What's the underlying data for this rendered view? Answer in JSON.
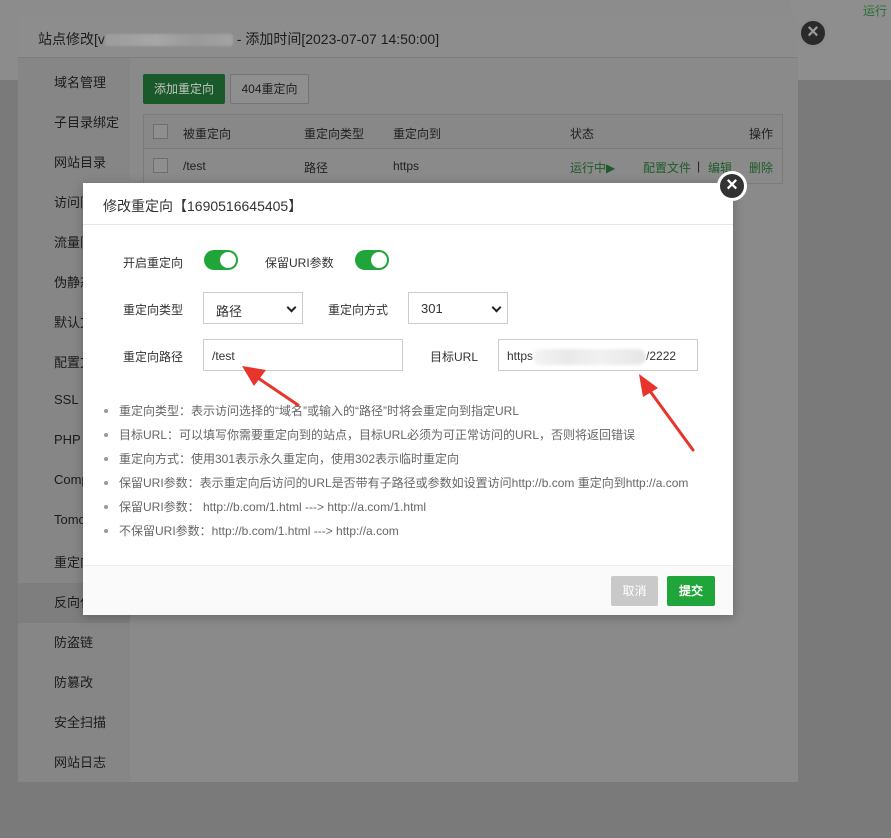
{
  "background": {
    "run_status": "运行"
  },
  "outer_modal": {
    "title_prefix": "站点修改[",
    "title_prefix_tail": "v",
    "title_suffix": " - 添加时间[2023-07-07 14:50:00]",
    "close_glyph": "×",
    "sidebar": [
      "域名管理",
      "子目录绑定",
      "网站目录",
      "访问限",
      "流量限",
      "伪静态",
      "默认文",
      "配置文",
      "SSL",
      "PHP",
      "Comp",
      "Tomc",
      "重定向",
      "反向代",
      "防盗链",
      "防篡改",
      "安全扫描",
      "网站日志"
    ],
    "buttons": {
      "add": "添加重定向",
      "not_found": "404重定向"
    },
    "table": {
      "headers": {
        "source": "被重定向",
        "type": "重定向类型",
        "target": "重定向到",
        "status": "状态",
        "ops": "操作"
      },
      "row": {
        "source": "/test",
        "type": "路径",
        "target": "https",
        "status": "运行中▶",
        "op_config": "配置文件",
        "op_sep": "|",
        "op_edit": "编辑",
        "op_delete": "删除"
      }
    }
  },
  "inner_modal": {
    "title": "修改重定向【1690516645405】",
    "close_glyph": "×",
    "enable_label": "开启重定向",
    "enable_on": true,
    "keep_uri_label": "保留URI参数",
    "keep_uri_on": true,
    "type_label": "重定向类型",
    "type_value": "路径",
    "method_label": "重定向方式",
    "method_value": "301",
    "path_label": "重定向路径",
    "path_value": "/test",
    "target_label": "目标URL",
    "target_prefix": "https",
    "target_suffix": "/2222",
    "tips": [
      "重定向类型：表示访问选择的“域名”或输入的“路径”时将会重定向到指定URL",
      "目标URL：可以填写你需要重定向到的站点，目标URL必须为可正常访问的URL，否则将返回错误",
      "重定向方式：使用301表示永久重定向，使用302表示临时重定向",
      "保留URI参数：表示重定向后访问的URL是否带有子路径或参数如设置访问http://b.com 重定向到http://a.com",
      "保留URI参数：  http://b.com/1.html ---> http://a.com/1.html",
      "不保留URI参数：http://b.com/1.html ---> http://a.com"
    ],
    "cancel_label": "取消",
    "submit_label": "提交"
  },
  "colors": {
    "accent": "#20a53a",
    "arrow": "#e8342a"
  }
}
